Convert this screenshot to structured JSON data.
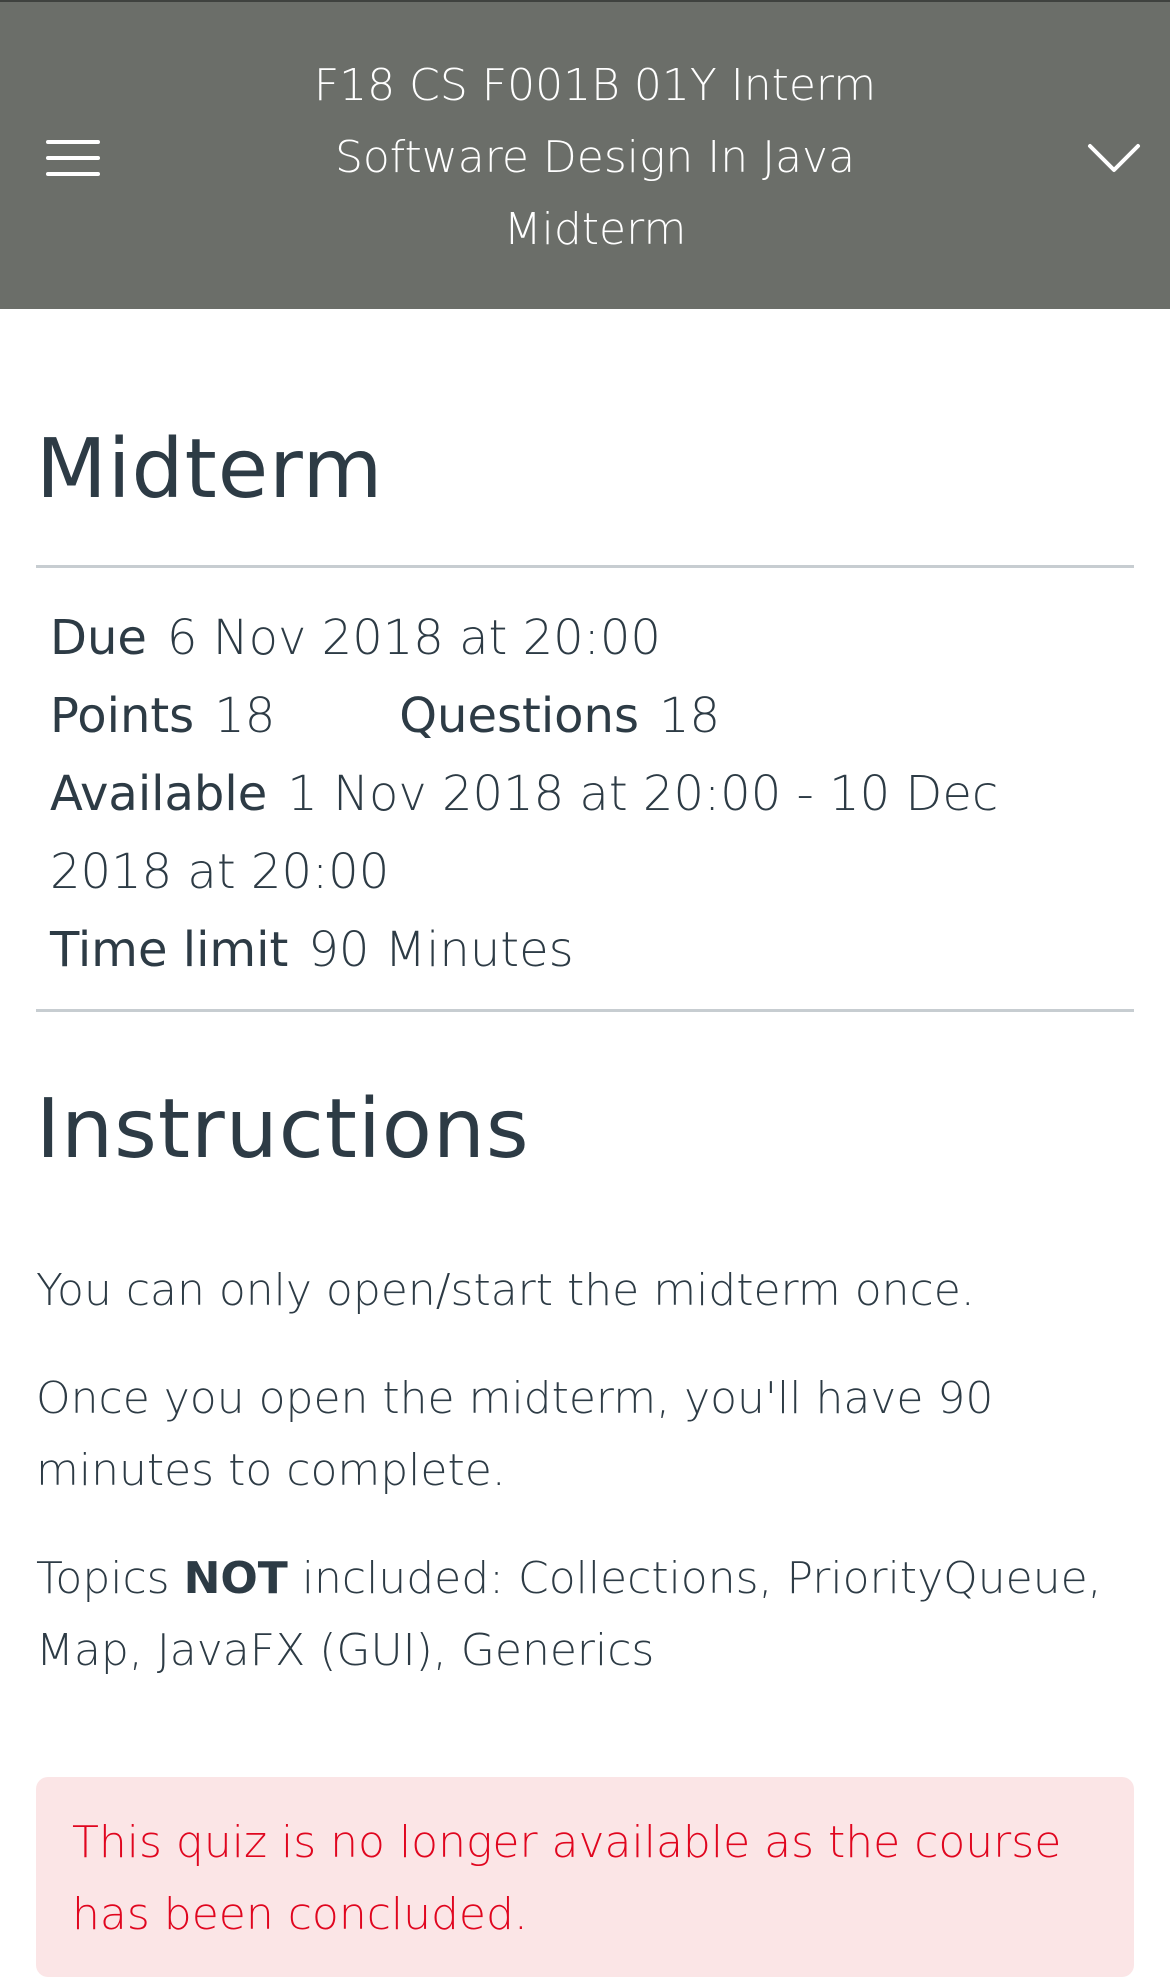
{
  "header": {
    "title_lines": [
      "F18 CS F001B 01Y Interm",
      "Software Design In Java",
      "Midterm"
    ],
    "menu_icon": "hamburger-menu-icon",
    "dropdown_icon": "chevron-down-icon",
    "background_color": "#6b6e69"
  },
  "quiz": {
    "title": "Midterm",
    "due_label": "Due",
    "due_value": "6 Nov 2018 at 20:00",
    "points_label": "Points",
    "points_value": "18",
    "questions_label": "Questions",
    "questions_value": "18",
    "available_label": "Available",
    "available_value": "1 Nov 2018 at 20:00 - 10 Dec 2018 at 20:00",
    "time_limit_label": "Time limit",
    "time_limit_value": "90 Minutes"
  },
  "instructions": {
    "title": "Instructions",
    "p1": "You can only open/start the midterm once.",
    "p2": "Once you open the midterm, you'll have 90 minutes to complete.",
    "p3_prefix": "Topics ",
    "p3_bold": "NOT",
    "p3_suffix": " included: Collections, PriorityQueue, Map, JavaFX (GUI), Generics"
  },
  "alert": {
    "text": "This quiz is no longer available as the course has been concluded.",
    "text_color": "#e0061f",
    "background_color": "#fbe5e6"
  }
}
